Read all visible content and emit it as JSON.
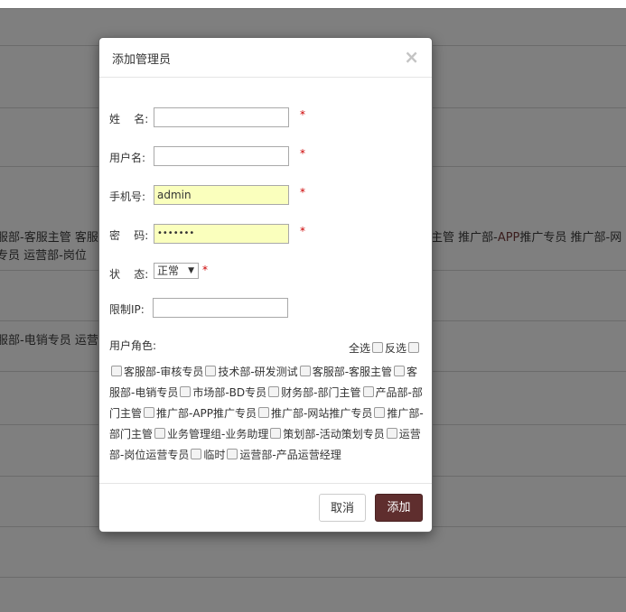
{
  "background": {
    "row1": [
      "服部-客服主管 客服",
      "主管 推广部-",
      "APP",
      "推广专员 推广部-网"
    ],
    "row1b": "专员 运营部-岗位",
    "row2": "服部-电销专员 运营"
  },
  "modal": {
    "title": "添加管理员",
    "close": "×",
    "fields": {
      "name": {
        "label": "姓    名:",
        "value": "",
        "required": "*"
      },
      "username": {
        "label": "用户名:",
        "value": "",
        "required": "*"
      },
      "phone": {
        "label": "手机号:",
        "value": "admin",
        "required": "*"
      },
      "password": {
        "label": "密    码:",
        "value": "•••••••",
        "required": "*"
      },
      "status": {
        "label": "状    态:",
        "selected": "正常",
        "required": "*"
      },
      "ip": {
        "label": "限制IP:",
        "value": ""
      }
    },
    "roles": {
      "label": "用户角色:",
      "select_all": "全选",
      "invert": "反选",
      "items": [
        "客服部-审核专员",
        "技术部-研发测试",
        "客服部-客服主管",
        "客服部-电销专员",
        "市场部-BD专员",
        "财务部-部门主管",
        "产品部-部门主管",
        "推广部-APP推广专员",
        "推广部-网站推广专员",
        "推广部-部门主管",
        "业务管理组-业务助理",
        "策划部-活动策划专员",
        "运营部-岗位运营专员",
        "临时",
        "运营部-产品运营经理"
      ]
    },
    "buttons": {
      "cancel": "取消",
      "add": "添加"
    }
  }
}
